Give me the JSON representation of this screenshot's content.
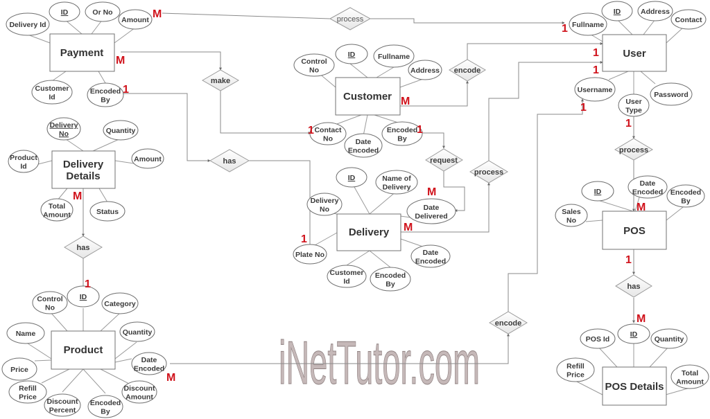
{
  "watermark": "iNetTutor.com",
  "colors": {
    "cardinality": "#d0121b",
    "watermark_fill": "#c5b8b8",
    "line": "#8a8a8a"
  },
  "entities": [
    {
      "id": "payment",
      "label": "Payment",
      "attributes": [
        {
          "label": "Delivery Id"
        },
        {
          "label": "ID",
          "key": true
        },
        {
          "label": "Or No"
        },
        {
          "label": "Amount"
        },
        {
          "label": "Customer Id"
        },
        {
          "label": "Encoded By"
        }
      ]
    },
    {
      "id": "delivery_details",
      "label": "Delivery Details",
      "attributes": [
        {
          "label": "Delivery No",
          "key": true
        },
        {
          "label": "Quantity"
        },
        {
          "label": "Product Id"
        },
        {
          "label": "Amount"
        },
        {
          "label": "Total Amount"
        },
        {
          "label": "Status"
        }
      ]
    },
    {
      "id": "product",
      "label": "Product",
      "attributes": [
        {
          "label": "Control No"
        },
        {
          "label": "ID",
          "key": true
        },
        {
          "label": "Category"
        },
        {
          "label": "Name"
        },
        {
          "label": "Quantity"
        },
        {
          "label": "Price"
        },
        {
          "label": "Date Encoded"
        },
        {
          "label": "Refill Price"
        },
        {
          "label": "Discount Percent"
        },
        {
          "label": "Encoded By"
        },
        {
          "label": "Discount Amount"
        }
      ]
    },
    {
      "id": "customer",
      "label": "Customer",
      "attributes": [
        {
          "label": "Control No"
        },
        {
          "label": "ID",
          "key": true
        },
        {
          "label": "Fullname"
        },
        {
          "label": "Address"
        },
        {
          "label": "Contact No"
        },
        {
          "label": "Date Encoded"
        },
        {
          "label": "Encoded By"
        }
      ]
    },
    {
      "id": "delivery",
      "label": "Delivery",
      "attributes": [
        {
          "label": "ID",
          "key": true
        },
        {
          "label": "Name of Delivery"
        },
        {
          "label": "Delivery No"
        },
        {
          "label": "Date Delivered"
        },
        {
          "label": "Plate No"
        },
        {
          "label": "Date Encoded"
        },
        {
          "label": "Customer Id"
        },
        {
          "label": "Encoded By"
        }
      ]
    },
    {
      "id": "user",
      "label": "User",
      "attributes": [
        {
          "label": "ID",
          "key": true
        },
        {
          "label": "Address"
        },
        {
          "label": "Contact"
        },
        {
          "label": "Fullname"
        },
        {
          "label": "Username"
        },
        {
          "label": "Password"
        },
        {
          "label": "User Type"
        }
      ]
    },
    {
      "id": "pos",
      "label": "POS",
      "attributes": [
        {
          "label": "ID",
          "key": true
        },
        {
          "label": "Date Encoded"
        },
        {
          "label": "Encoded By"
        },
        {
          "label": "Sales No"
        }
      ]
    },
    {
      "id": "pos_details",
      "label": "POS Details",
      "attributes": [
        {
          "label": "POS Id"
        },
        {
          "label": "ID",
          "key": true
        },
        {
          "label": "Quantity"
        },
        {
          "label": "Refill Price"
        },
        {
          "label": "Total Amount"
        }
      ]
    }
  ],
  "relationships": [
    {
      "id": "process_top",
      "label": "process",
      "from": "Payment.Amount",
      "to": "User.Fullname",
      "from_card": "M",
      "to_card": "1"
    },
    {
      "id": "make",
      "label": "make",
      "from": "Payment",
      "to": "Customer.Contact No",
      "from_card": "M",
      "to_card": "1"
    },
    {
      "id": "has_payment_delivery",
      "label": "has",
      "from": "Payment.Encoded By",
      "to": "Delivery.Plate No",
      "from_card": "1",
      "to_card": "1"
    },
    {
      "id": "encode_customer",
      "label": "encode",
      "from": "Customer",
      "to": "User",
      "from_card": "M",
      "to_card": "1"
    },
    {
      "id": "request",
      "label": "request",
      "from": "Customer.Encoded By",
      "to": "Delivery.Date Delivered",
      "from_card": "1",
      "to_card": "M"
    },
    {
      "id": "process_delivery",
      "label": "process",
      "from": "Delivery",
      "to": "User",
      "from_card": "M",
      "to_card": "1"
    },
    {
      "id": "has_details_product",
      "label": "has",
      "from": "Delivery Details",
      "to": "Product.ID",
      "from_card": "M",
      "to_card": "1"
    },
    {
      "id": "encode_product",
      "label": "encode",
      "from": "Product.Date Encoded",
      "to": "User.Username",
      "from_card": "M",
      "to_card": "1"
    },
    {
      "id": "process_pos",
      "label": "process",
      "from": "User.User Type",
      "to": "POS",
      "from_card": "1",
      "to_card": "M"
    },
    {
      "id": "has_pos",
      "label": "has",
      "from": "POS",
      "to": "POS Details.ID",
      "from_card": "1",
      "to_card": "M"
    }
  ]
}
